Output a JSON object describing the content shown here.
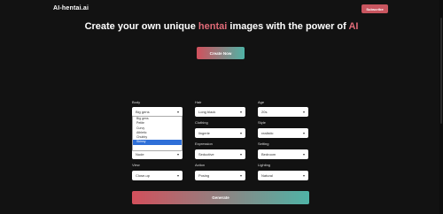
{
  "header": {
    "logo": "AI-hentai.ai",
    "auth_button": "Subscribe"
  },
  "hero": {
    "title_part1": "Create your own unique ",
    "title_accent1": "hentai",
    "title_part2": " images with the power of ",
    "title_accent2": "AI",
    "cta": "Create Now"
  },
  "form": {
    "fields": [
      {
        "label": "Body",
        "value": "Big gens"
      },
      {
        "label": "Hair",
        "value": "Long black"
      },
      {
        "label": "Age",
        "value": "20s"
      },
      {
        "label": "",
        "value": ""
      },
      {
        "label": "Clothing",
        "value": "lingerie"
      },
      {
        "label": "Style",
        "value": "realistic"
      },
      {
        "label": "",
        "value": "Nude"
      },
      {
        "label": "Expression",
        "value": "Seductive"
      },
      {
        "label": "Setting",
        "value": "Bedroom"
      },
      {
        "label": "View",
        "value": "Close-up"
      },
      {
        "label": "Action",
        "value": "Posing"
      },
      {
        "label": "Lighting",
        "value": "Natural"
      }
    ],
    "dropdown_options": [
      "Big gens",
      "Petite",
      "Curvy",
      "Athletic",
      "Chubby",
      "Skinny"
    ],
    "dropdown_selected_index": 5,
    "generate": "Generate"
  },
  "colors": {
    "background": "#121212",
    "accent_red": "#d2505c",
    "accent_teal": "#4fb3a6",
    "selected_blue": "#2e6fd8"
  }
}
